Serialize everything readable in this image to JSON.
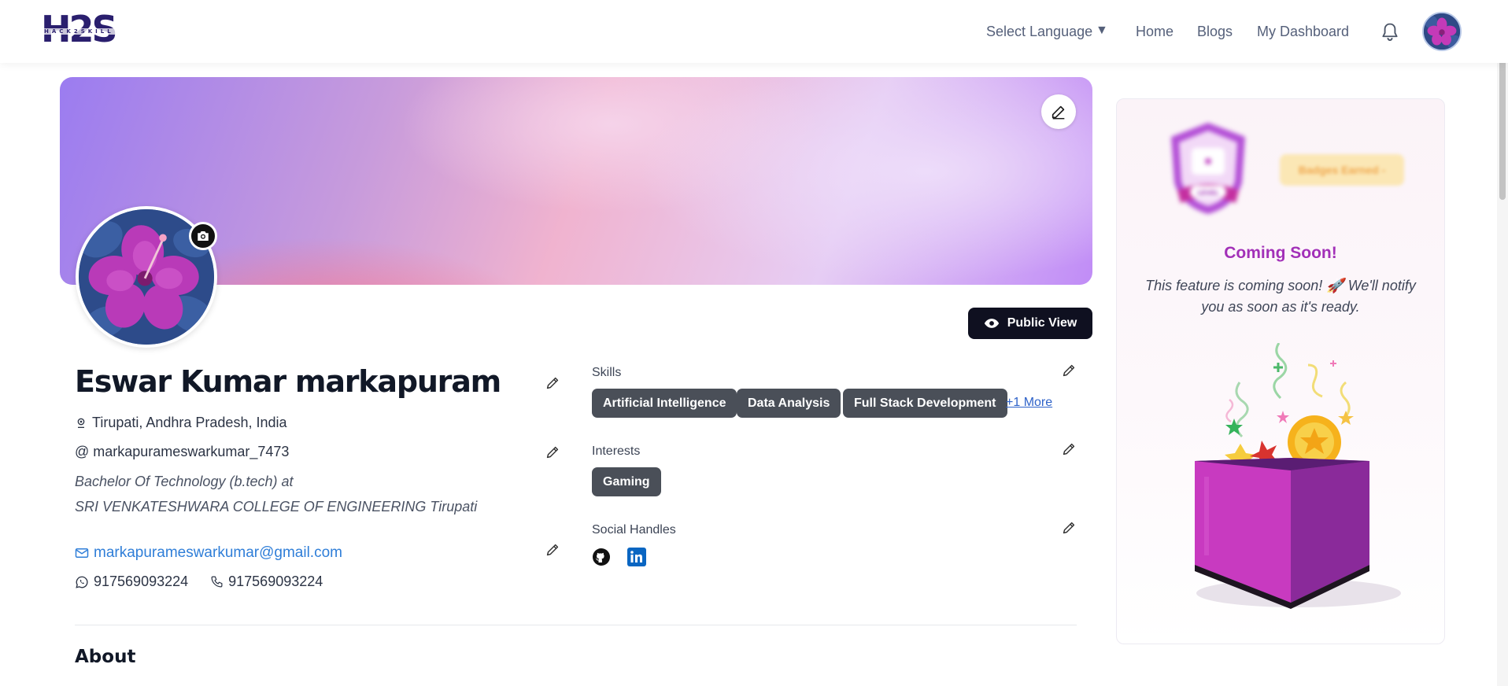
{
  "nav": {
    "logo_text": "H2S",
    "logo_subtext": "HACK2SKILL",
    "language_label": "Select Language",
    "language_arrow": "▼",
    "links": [
      "Home",
      "Blogs",
      "My Dashboard"
    ],
    "bell_icon": "bell-icon",
    "avatar_icon": "hibiscus-avatar"
  },
  "profile": {
    "banner_edit_icon": "pencil-icon",
    "camera_icon": "camera-icon",
    "public_view_label": "Public View",
    "name": "Eswar Kumar markapuram",
    "location": "Tirupati, Andhra Pradesh, India",
    "username": "@ markapurameswarkumar_7473",
    "degree": "Bachelor Of Technology (b.tech) at",
    "college": "SRI VENKATESHWARA COLLEGE OF ENGINEERING Tirupati",
    "email": "markapurameswarkumar@gmail.com",
    "whatsapp": "917569093224",
    "phone": "917569093224",
    "about_heading": "About"
  },
  "skills": {
    "label": "Skills",
    "items": [
      "Artificial Intelligence",
      "Data Analysis",
      "Full Stack Development"
    ],
    "more": "+1 More"
  },
  "interests": {
    "label": "Interests",
    "items": [
      "Gaming"
    ]
  },
  "social": {
    "label": "Social Handles",
    "icons": [
      "github-icon",
      "linkedin-icon"
    ]
  },
  "badges": {
    "pill_label": "Badges Earned -",
    "shield_text": "LEVEL",
    "title": "Coming Soon!",
    "text": "This feature is coming soon! 🚀 We'll notify you as soon as it's ready."
  },
  "colors": {
    "accent_blue": "#2f7ed8",
    "chip_bg": "#4a4f58",
    "button_dark": "#0f1020",
    "coming_soon": "#a230b8"
  }
}
